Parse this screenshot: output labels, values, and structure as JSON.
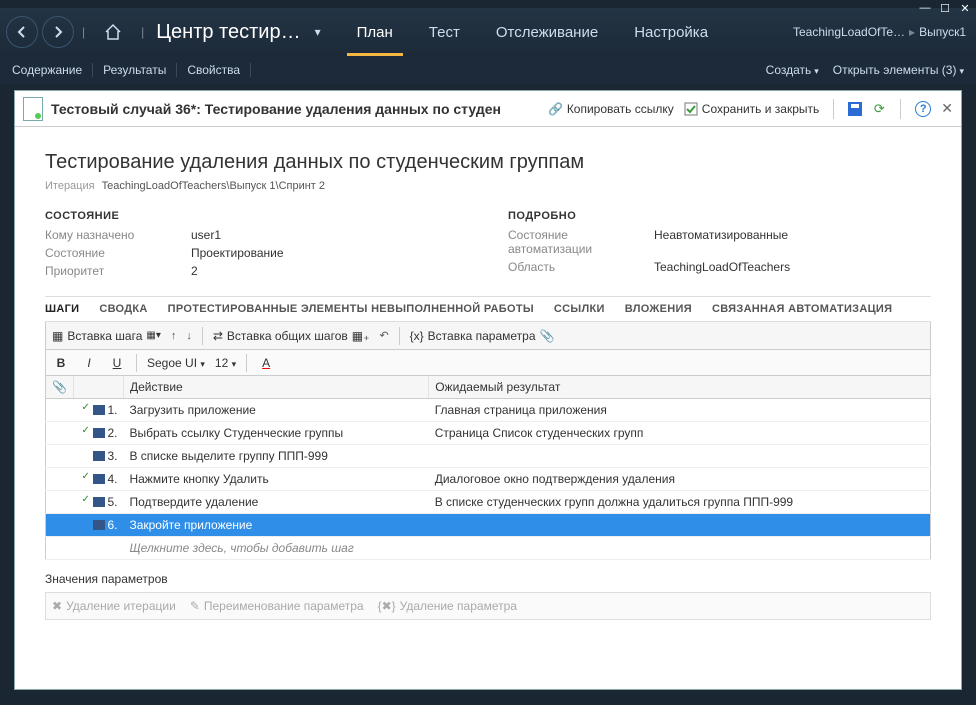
{
  "window": {
    "minimize": "—",
    "maximize": "☐",
    "close": "✕"
  },
  "nav": {
    "breadcrumb_title": "Центр тестир…",
    "tabs": [
      {
        "label": "План",
        "active": true
      },
      {
        "label": "Тест",
        "active": false
      },
      {
        "label": "Отслеживание",
        "active": false
      },
      {
        "label": "Настройка",
        "active": false
      }
    ],
    "crumb_right_project": "TeachingLoadOfTe…",
    "crumb_right_release": "Выпуск1"
  },
  "subnav": {
    "items": [
      "Содержание",
      "Результаты",
      "Свойства"
    ],
    "create": "Создать",
    "open_elements": "Открыть элементы (3)"
  },
  "panel": {
    "title": "Тестовый случай 36*: Тестирование удаления данных по студен",
    "copy_link": "Копировать ссылку",
    "save_close": "Сохранить и закрыть"
  },
  "test": {
    "title": "Тестирование удаления данных по студенческим группам",
    "iter_label": "Итерация",
    "iter_path": "TeachingLoadOfTeachers\\Выпуск 1\\Спринт 2",
    "state_head": "СОСТОЯНИЕ",
    "detail_head": "ПОДРОБНО",
    "kv_left": [
      {
        "k": "Кому назначено",
        "v": "user1"
      },
      {
        "k": "Состояние",
        "v": "Проектирование"
      },
      {
        "k": "Приоритет",
        "v": "2"
      }
    ],
    "kv_right": [
      {
        "k": "Состояние автоматизации",
        "v": "Неавтоматизированные"
      },
      {
        "k": "Область",
        "v": "TeachingLoadOfTeachers"
      }
    ]
  },
  "tabs_row": [
    "ШАГИ",
    "СВОДКА",
    "ПРОТЕСТИРОВАННЫЕ ЭЛЕМЕНТЫ НЕВЫПОЛНЕННОЙ РАБОТЫ",
    "ССЫЛКИ",
    "ВЛОЖЕНИЯ",
    "СВЯЗАННАЯ АВТОМАТИЗАЦИЯ"
  ],
  "toolbar1": {
    "insert_step": "Вставка шага",
    "insert_shared": "Вставка общих шагов",
    "insert_param": "Вставка параметра"
  },
  "toolbar2": {
    "font": "Segoe UI",
    "size": "12"
  },
  "steps": {
    "cols": {
      "attach": "",
      "num": "",
      "action": "Действие",
      "expected": "Ожидаемый результат"
    },
    "rows": [
      {
        "num": "1.",
        "action": "Загрузить приложение",
        "expected": "Главная страница приложения",
        "check": true
      },
      {
        "num": "2.",
        "action": "Выбрать ссылку Студенческие группы",
        "expected": "Страница Список студенческих групп",
        "check": true
      },
      {
        "num": "3.",
        "action": "В списке выделите группу ППП-999",
        "expected": "",
        "check": false
      },
      {
        "num": "4.",
        "action": "Нажмите кнопку Удалить",
        "expected": "Диалоговое окно подтверждения удаления",
        "check": true
      },
      {
        "num": "5.",
        "action": "Подтвердите удаление",
        "expected": "В списке студенческих групп должна удалиться группа ППП-999",
        "check": true
      },
      {
        "num": "6.",
        "action": "Закройте приложение",
        "expected": "",
        "check": false,
        "selected": true
      }
    ],
    "placeholder": "Щелкните здесь, чтобы добавить шаг"
  },
  "params": {
    "heading": "Значения параметров",
    "delete_iter": "Удаление итерации",
    "rename_param": "Переименование параметра",
    "delete_param": "Удаление параметра"
  }
}
